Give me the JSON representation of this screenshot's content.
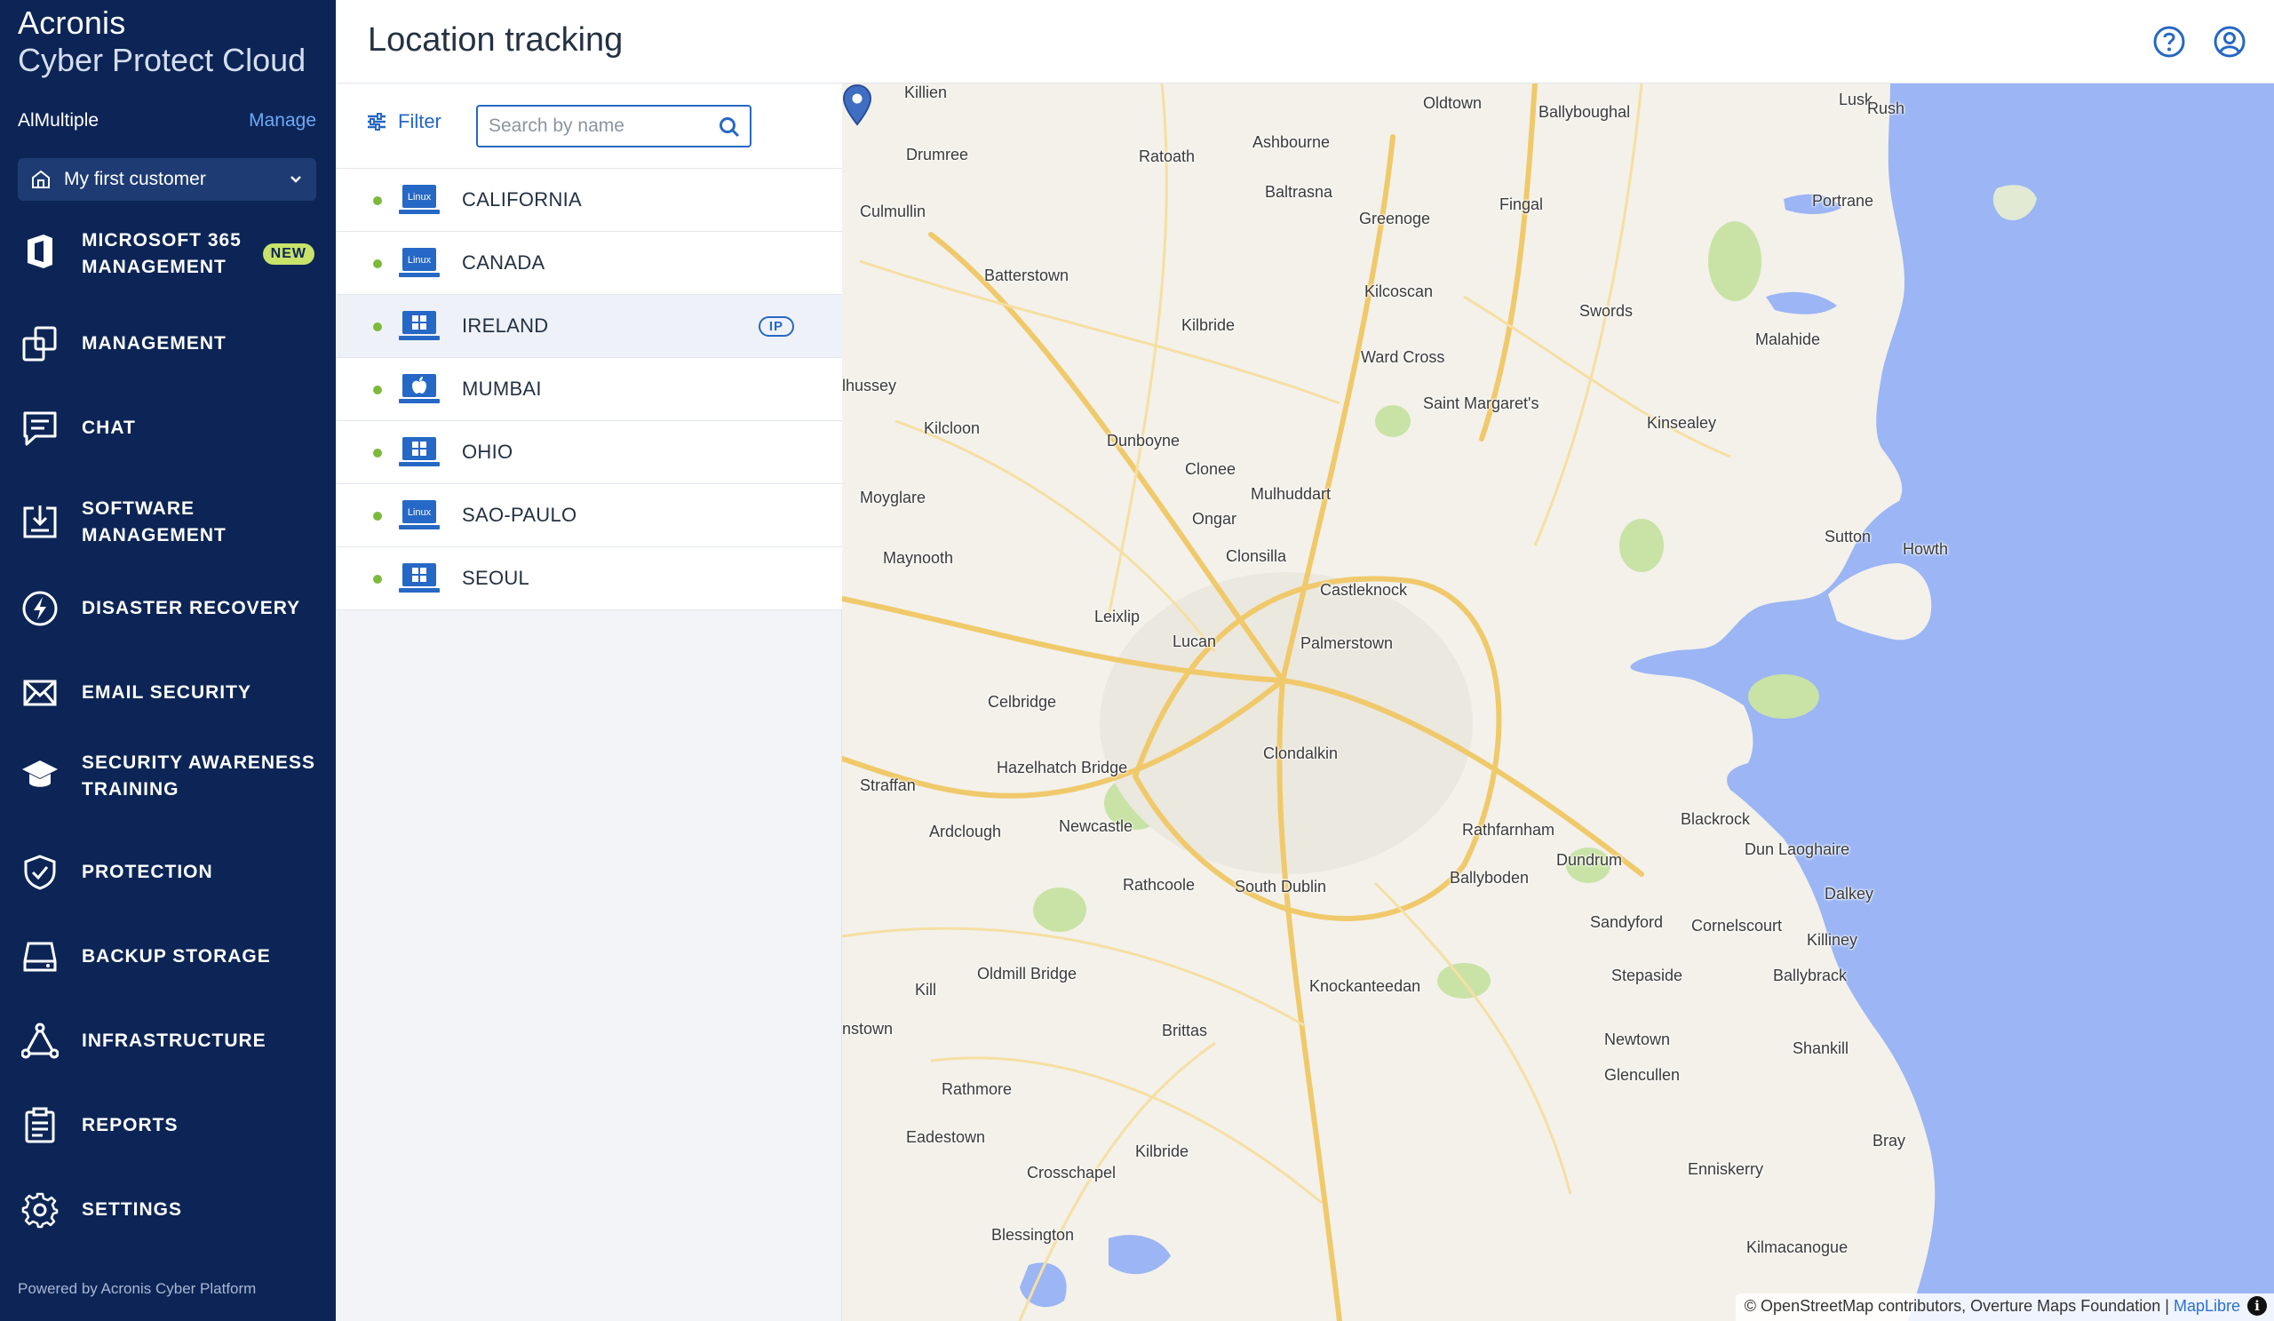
{
  "brand": {
    "name": "Acronis",
    "product": "Cyber Protect Cloud"
  },
  "tenant": {
    "name": "AlMultiple",
    "manage_label": "Manage"
  },
  "customer_select": {
    "value": "My first customer"
  },
  "nav": {
    "items": [
      {
        "label": "MICROSOFT 365 MANAGEMENT",
        "badge": "NEW",
        "icon": "office-icon"
      },
      {
        "label": "MANAGEMENT",
        "icon": "management-icon"
      },
      {
        "label": "CHAT",
        "icon": "chat-icon"
      },
      {
        "label": "SOFTWARE MANAGEMENT",
        "icon": "software-icon"
      },
      {
        "label": "DISASTER RECOVERY",
        "icon": "lightning-icon"
      },
      {
        "label": "EMAIL SECURITY",
        "icon": "envelope-icon"
      },
      {
        "label": "SECURITY AWARENESS TRAINING",
        "icon": "graduation-cap-icon"
      },
      {
        "label": "PROTECTION",
        "icon": "shield-icon"
      },
      {
        "label": "BACKUP STORAGE",
        "icon": "storage-icon"
      },
      {
        "label": "INFRASTRUCTURE",
        "icon": "network-icon"
      },
      {
        "label": "REPORTS",
        "icon": "report-icon"
      },
      {
        "label": "SETTINGS",
        "icon": "gear-icon"
      }
    ],
    "item0_line1": "MICROSOFT 365",
    "item0_line2": "MANAGEMENT",
    "item3_line1": "SOFTWARE",
    "item3_line2": "MANAGEMENT",
    "item6_line1": "SECURITY AWARENESS",
    "item6_line2": "TRAINING"
  },
  "footer": {
    "powered_by": "Powered by Acronis Cyber Platform"
  },
  "header": {
    "title": "Location tracking"
  },
  "toolbar": {
    "filter_label": "Filter",
    "search_placeholder": "Search by name",
    "search_value": ""
  },
  "devices": [
    {
      "name": "CALIFORNIA",
      "os": "linux",
      "os_label": "Linux",
      "status": "online"
    },
    {
      "name": "CANADA",
      "os": "linux",
      "os_label": "Linux",
      "status": "online"
    },
    {
      "name": "IRELAND",
      "os": "windows",
      "status": "online",
      "badge": "IP",
      "selected": true
    },
    {
      "name": "MUMBAI",
      "os": "mac",
      "status": "online"
    },
    {
      "name": "OHIO",
      "os": "windows",
      "status": "online"
    },
    {
      "name": "SAO-PAULO",
      "os": "linux",
      "os_label": "Linux",
      "status": "online"
    },
    {
      "name": "SEOUL",
      "os": "windows",
      "status": "online"
    }
  ],
  "map": {
    "places": [
      "Killien",
      "Oldtown",
      "Ballyboughal",
      "Lusk",
      "Rush",
      "Drumree",
      "Ratoath",
      "Ashbourne",
      "Baltrasna",
      "Greenoge",
      "Fingal",
      "Portrane",
      "Culmullin",
      "Batterstown",
      "Kilcoscan",
      "Swords",
      "Malahide",
      "Kilbride",
      "Ward Cross",
      "Saint Margaret's",
      "Kinsealey",
      "lhussey",
      "Kilcloon",
      "Dunboyne",
      "Clonee",
      "Mulhuddart",
      "Moyglare",
      "Ongar",
      "Clonsilla",
      "Sutton",
      "Howth",
      "Maynooth",
      "Castleknock",
      "Leixlip",
      "Lucan",
      "Palmerstown",
      "Celbridge",
      "Hazelhatch Bridge",
      "Clondalkin",
      "Straffan",
      "Ardclough",
      "Newcastle",
      "Rathfarnham",
      "Blackrock",
      "Dun Laoghaire",
      "Dundrum",
      "Ballyboden",
      "Rathcoole",
      "South Dublin",
      "Dalkey",
      "Sandyford",
      "Cornelscourt",
      "Killiney",
      "Stepaside",
      "Ballybrack",
      "Oldmill Bridge",
      "Kill",
      "Knockanteedan",
      "nstown",
      "Brittas",
      "Newtown",
      "Shankill",
      "Glencullen",
      "Rathmore",
      "Eadestown",
      "Kilbride",
      "Crosschapel",
      "Bray",
      "Enniskerry",
      "Blessington",
      "Kilmacanogue"
    ],
    "attribution_text": "© OpenStreetMap contributors, Overture Maps Foundation | ",
    "attribution_link": "MapLibre",
    "info_label": "i"
  },
  "colors": {
    "sidebar": "#0c2556",
    "accent": "#2668c5",
    "online": "#7bbb3b",
    "sea": "#9bb5f5",
    "badge_new": "#c8e26a"
  }
}
